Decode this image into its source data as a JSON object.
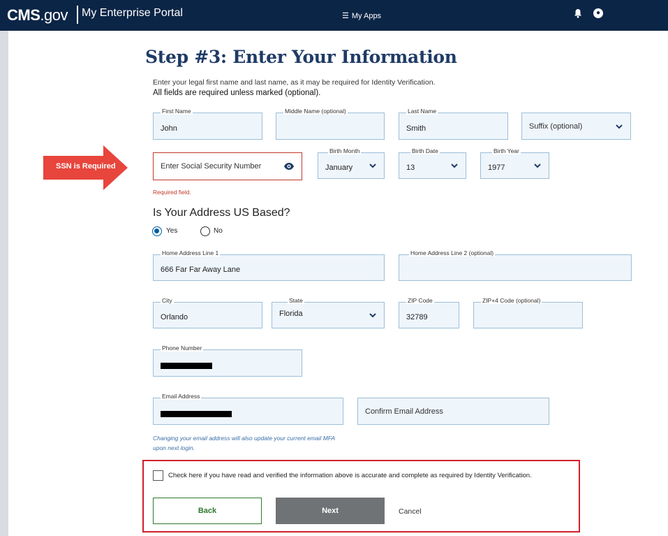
{
  "header": {
    "brand": "CMS",
    "brand_suffix": ".gov",
    "portal": "My Enterprise Portal",
    "my_apps": "My Apps"
  },
  "page": {
    "title": "Step #3: Enter Your Information",
    "intro": "Enter your legal first name and last name, as it may be required for Identity Verification.",
    "required_note": "All fields are required unless marked (optional)."
  },
  "annotation": {
    "callout": "SSN is Required",
    "color": "#e8453c"
  },
  "form": {
    "first_name": {
      "label": "First Name",
      "value": "John"
    },
    "middle_name": {
      "label": "Middle Name (optional)",
      "value": ""
    },
    "last_name": {
      "label": "Last Name",
      "value": "Smith"
    },
    "suffix": {
      "placeholder": "Suffix (optional)"
    },
    "ssn": {
      "placeholder": "Enter Social Security Number",
      "error": "Required field."
    },
    "birth_month": {
      "label": "Birth Month",
      "value": "January"
    },
    "birth_date": {
      "label": "Birth Date",
      "value": "13"
    },
    "birth_year": {
      "label": "Birth Year",
      "value": "1977"
    },
    "address_question": "Is Your Address US Based?",
    "address_options": [
      "Yes",
      "No"
    ],
    "address_selected": "Yes",
    "home_address_1": {
      "label": "Home Address Line 1",
      "value": "666 Far Far Away Lane"
    },
    "home_address_2": {
      "label": "Home Address Line 2 (optional)",
      "value": ""
    },
    "city": {
      "label": "City",
      "value": "Orlando"
    },
    "state": {
      "label": "State",
      "value": "Florida"
    },
    "zip": {
      "label": "ZIP Code",
      "value": "32789"
    },
    "zip4": {
      "label": "ZIP+4 Code (optional)",
      "value": ""
    },
    "phone": {
      "label": "Phone Number"
    },
    "email": {
      "label": "Email Address"
    },
    "confirm_email": {
      "placeholder": "Confirm Email Address"
    },
    "email_hint": "Changing your email address will also update your current email MFA upon next login.",
    "verify_checkbox": "Check here if you have read and verified the information above is accurate and complete as required by Identity Verification."
  },
  "actions": {
    "back": "Back",
    "next": "Next",
    "cancel": "Cancel"
  }
}
